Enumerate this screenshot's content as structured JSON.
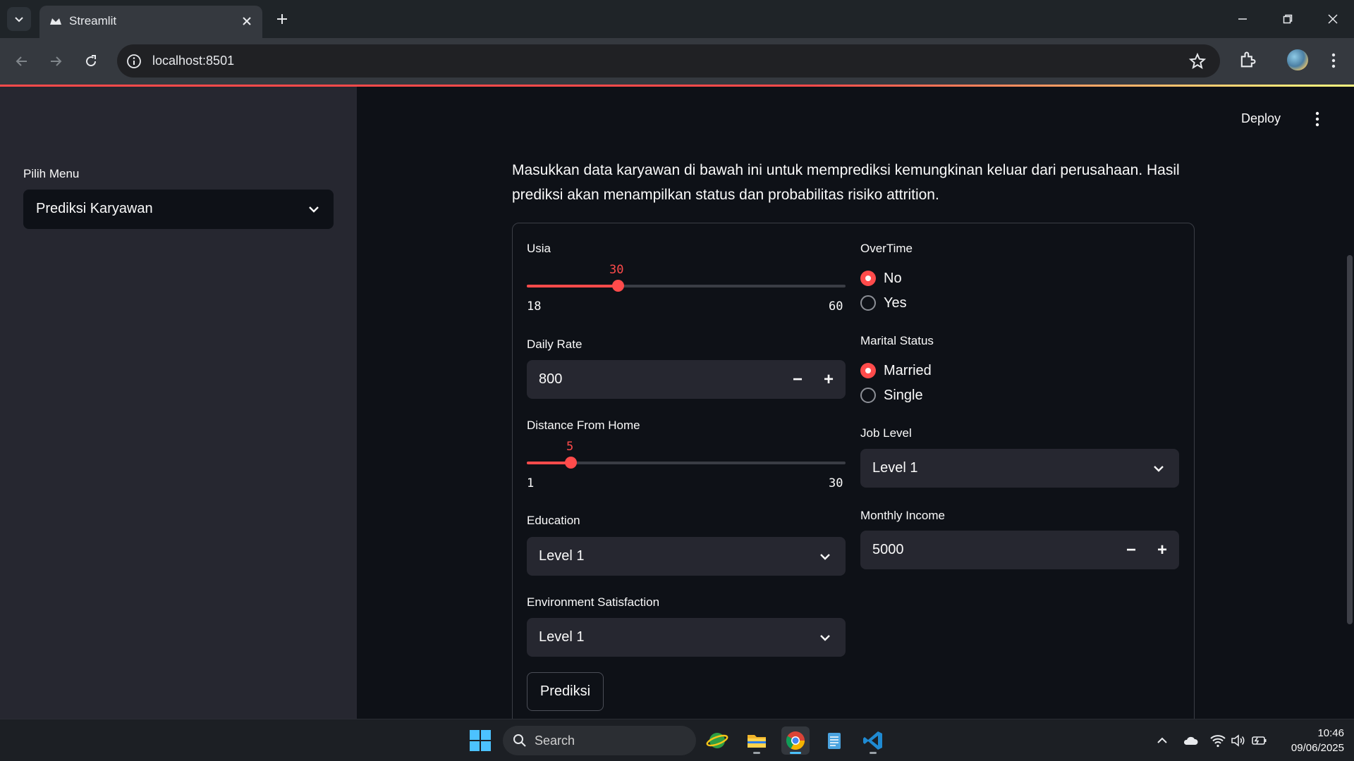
{
  "browser": {
    "tab_title": "Streamlit",
    "url": "localhost:8501"
  },
  "sidebar": {
    "label": "Pilih Menu",
    "selected_menu": "Prediksi Karyawan"
  },
  "header": {
    "deploy_label": "Deploy"
  },
  "intro_text": "Masukkan data karyawan di bawah ini untuk memprediksi kemungkinan keluar dari perusahaan. Hasil prediksi akan menampilkan status dan probabilitas risiko attrition.",
  "form": {
    "usia": {
      "label": "Usia",
      "value": "30",
      "min": "18",
      "max": "60"
    },
    "daily_rate": {
      "label": "Daily Rate",
      "value": "800",
      "minus": "−",
      "plus": "+"
    },
    "distance": {
      "label": "Distance From Home",
      "value": "5",
      "min": "1",
      "max": "30"
    },
    "education": {
      "label": "Education",
      "value": "Level 1"
    },
    "environment": {
      "label": "Environment Satisfaction",
      "value": "Level 1"
    },
    "overtime": {
      "label": "OverTime",
      "options": [
        "No",
        "Yes"
      ],
      "selected": "No"
    },
    "marital": {
      "label": "Marital Status",
      "options": [
        "Married",
        "Single"
      ],
      "selected": "Married"
    },
    "job_level": {
      "label": "Job Level",
      "value": "Level 1"
    },
    "monthly_income": {
      "label": "Monthly Income",
      "value": "5000",
      "minus": "−",
      "plus": "+"
    },
    "submit_label": "Prediksi"
  },
  "taskbar": {
    "search_label": "Search",
    "time": "10:46",
    "date": "09/06/2025"
  },
  "colors": {
    "accent": "#ff4b4b",
    "background": "#0e1117",
    "sidebar": "#262730"
  }
}
